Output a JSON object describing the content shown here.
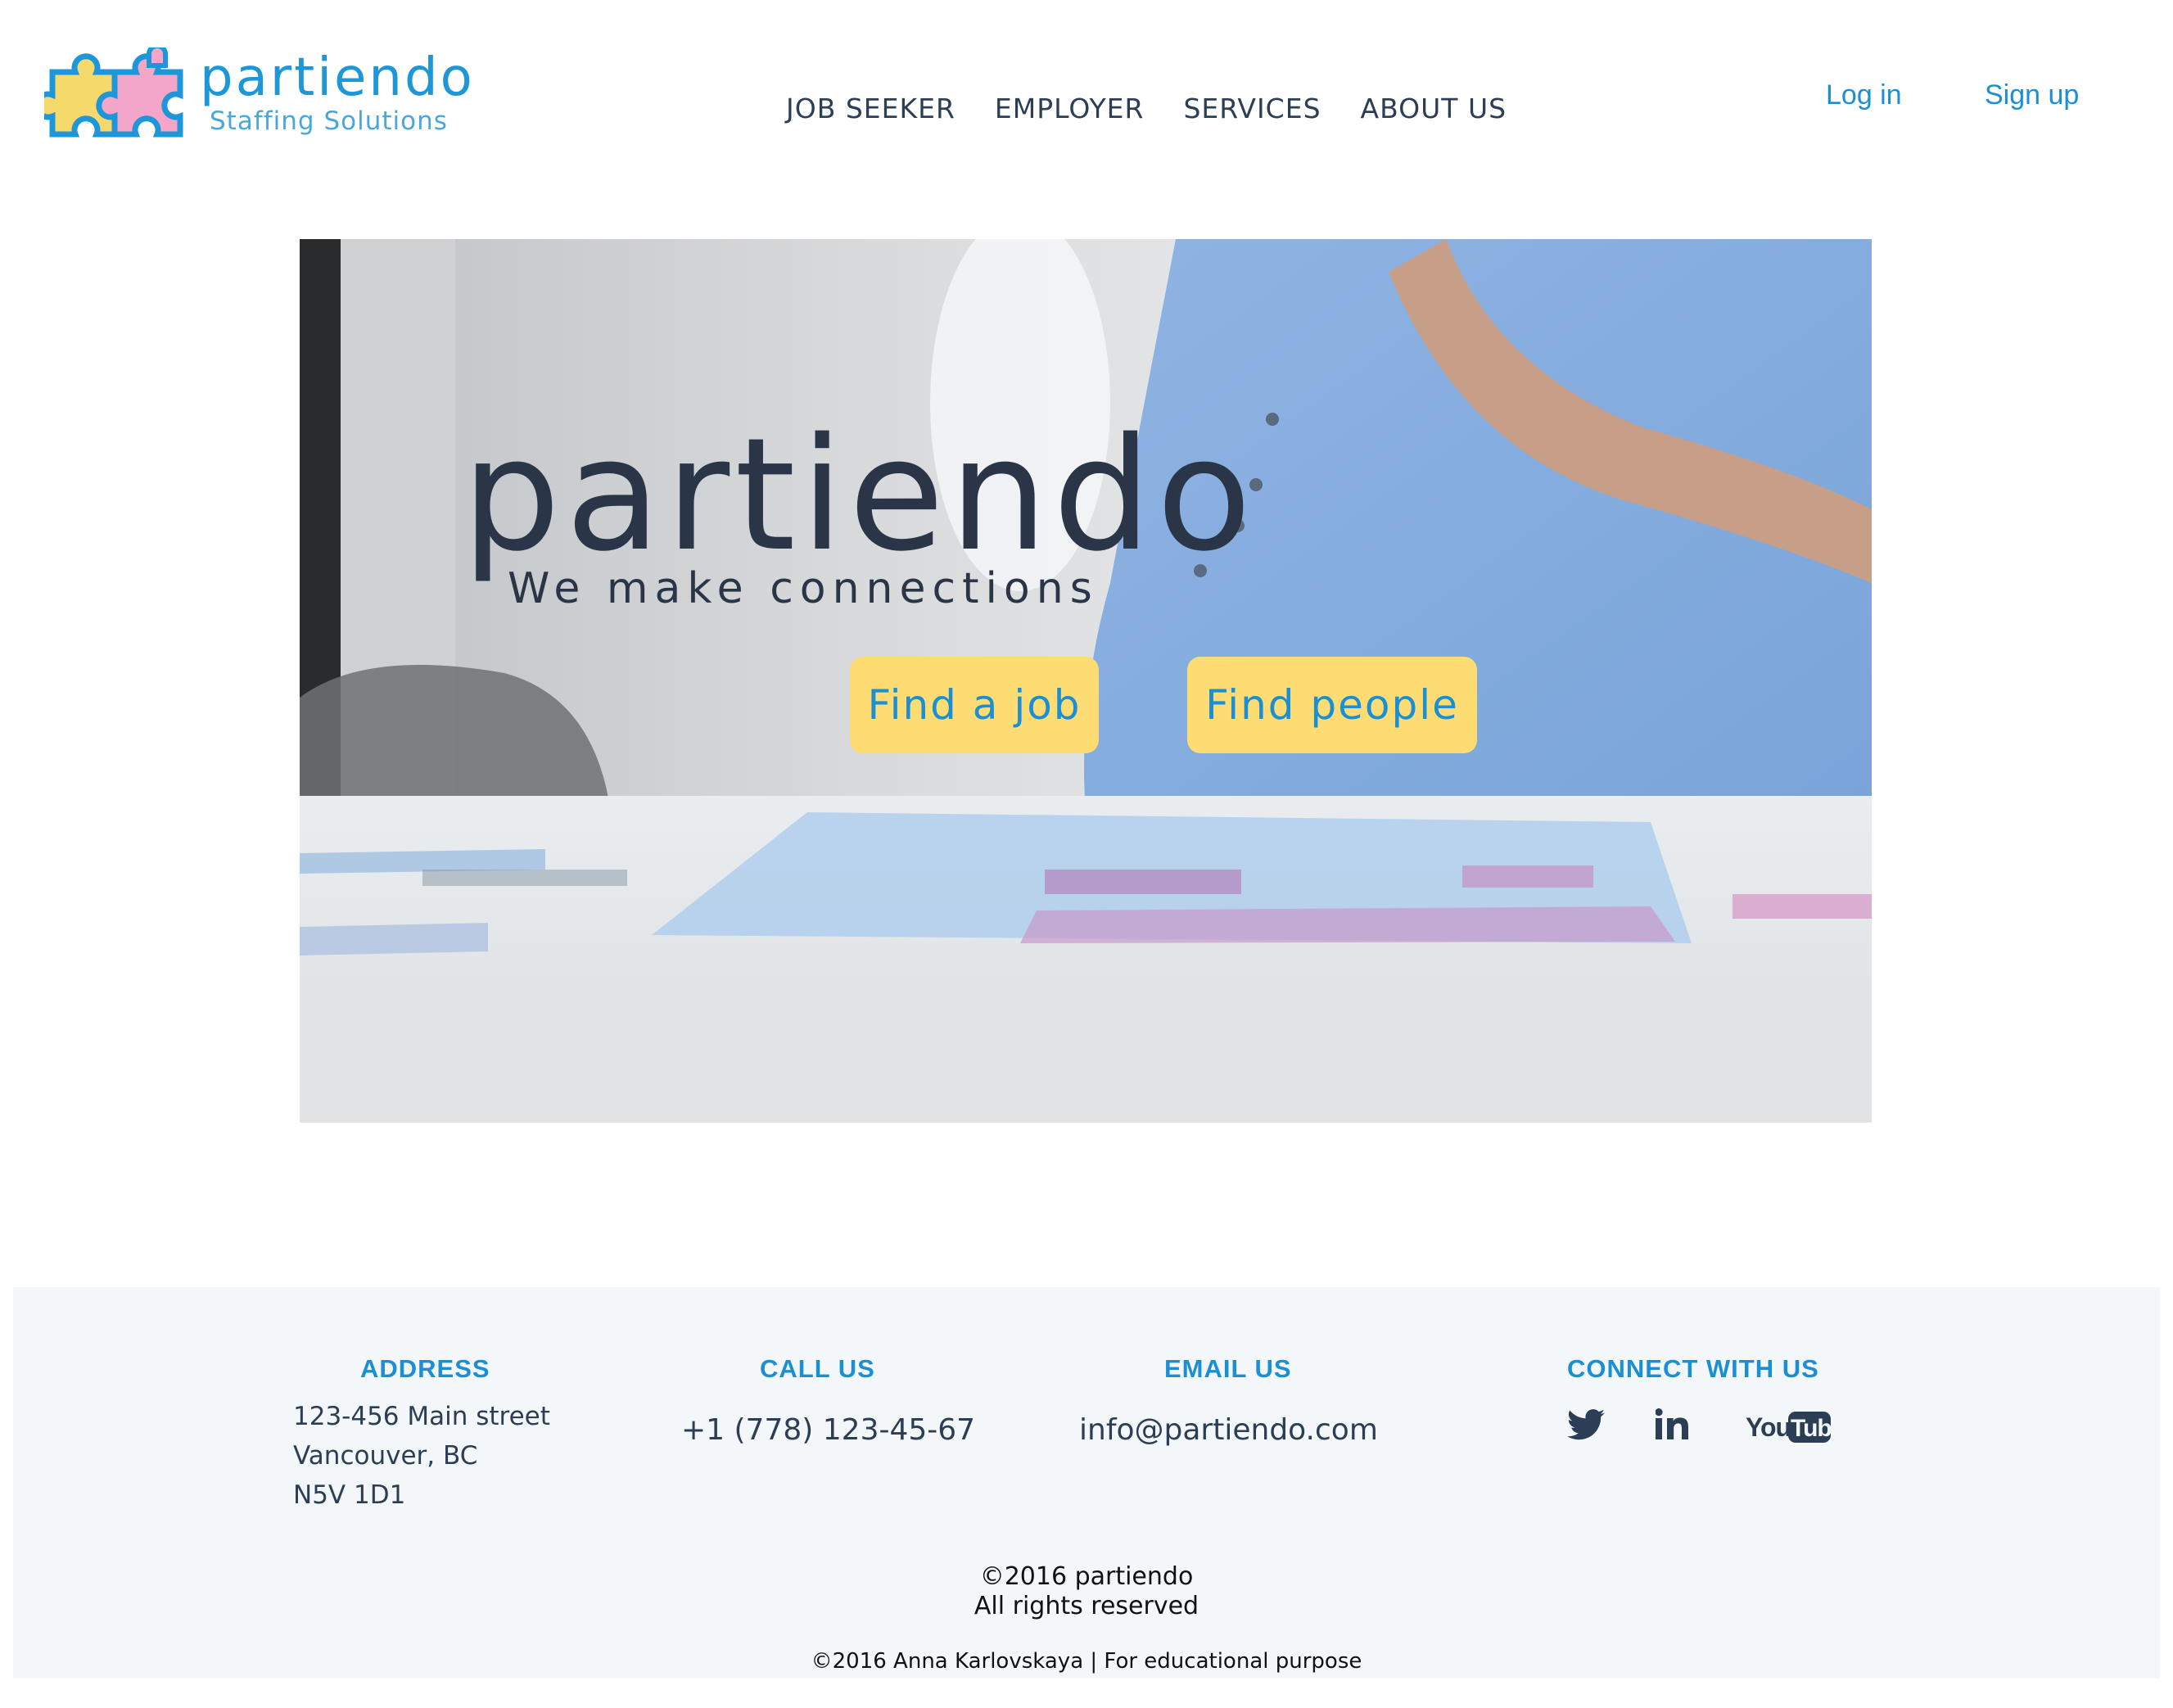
{
  "header": {
    "logo": {
      "name": "partiendo",
      "tagline": "Staffing Solutions",
      "icon": "puzzle-pieces-icon"
    },
    "nav": [
      {
        "label": "JOB SEEKER"
      },
      {
        "label": "EMPLOYER"
      },
      {
        "label": "SERVICES"
      },
      {
        "label": "ABOUT US"
      }
    ],
    "auth": {
      "login_label": "Log in",
      "signup_label": "Sign up"
    }
  },
  "hero": {
    "title": "partiendo",
    "subtitle": "We make connections",
    "buttons": {
      "find_job": "Find a job",
      "find_people": "Find people"
    }
  },
  "footer": {
    "address": {
      "heading": "ADDRESS",
      "lines": [
        "123-456 Main street",
        "Vancouver, BC",
        "N5V 1D1"
      ]
    },
    "call": {
      "heading": "CALL US",
      "phone": "+1 (778) 123-45-67"
    },
    "email": {
      "heading": "EMAIL US",
      "address": "info@partiendo.com"
    },
    "connect": {
      "heading": "CONNECT WITH US",
      "icons": [
        "twitter-icon",
        "linkedin-icon",
        "youtube-icon"
      ]
    },
    "copyright": [
      "©2016 partiendo",
      "All rights reserved"
    ],
    "credit": "©2016 Anna Karlovskaya | For educational purpose"
  },
  "colors": {
    "brand_blue": "#1b8fd3",
    "text_dark": "#2c3e55",
    "button_yellow": "#fddc73",
    "footer_bg": "#f3f7fa"
  }
}
